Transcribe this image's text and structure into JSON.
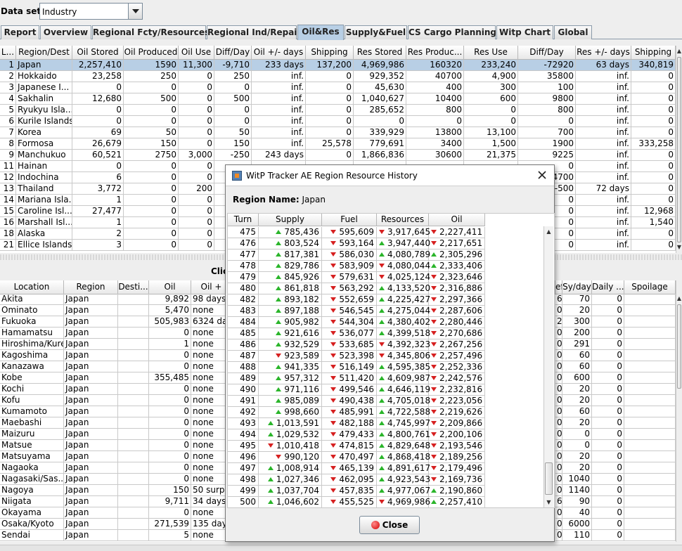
{
  "dataset": {
    "label": "Data set:",
    "value": "Industry"
  },
  "tabs": [
    "Report",
    "Overview",
    "Regional Fcty/Resources",
    "Regional Ind/Repair",
    "Oil&Res",
    "Supply&Fuel",
    "CS Cargo Planning",
    "Witp Chart",
    "Global"
  ],
  "active_tab": "Oil&Res",
  "region_table": {
    "columns": [
      "L...",
      "Region/Dest",
      "Oil Stored",
      "Oil Produced",
      "Oil Use",
      "Diff/Day",
      "Oil +/- days",
      "Shipping",
      "Res Stored",
      "Res Produc...",
      "Res Use",
      "Diff/Day",
      "Res +/- days",
      "Shipping"
    ],
    "rows": [
      [
        "1",
        "Japan",
        "2,257,410",
        "1590",
        "11,300",
        "-9,710",
        "233 days",
        "137,200",
        "4,969,986",
        "160320",
        "233,240",
        "-72920",
        "63 days",
        "340,819"
      ],
      [
        "2",
        "Hokkaido",
        "23,258",
        "250",
        "0",
        "250",
        "inf.",
        "0",
        "929,352",
        "40700",
        "4,900",
        "35800",
        "inf.",
        "0"
      ],
      [
        "3",
        "Japanese I...",
        "0",
        "0",
        "0",
        "0",
        "inf.",
        "0",
        "45,630",
        "400",
        "300",
        "100",
        "inf.",
        "0"
      ],
      [
        "4",
        "Sakhalin",
        "12,680",
        "500",
        "0",
        "500",
        "inf.",
        "0",
        "1,040,627",
        "10400",
        "600",
        "9800",
        "inf.",
        "0"
      ],
      [
        "5",
        "Ryukyu Isla...",
        "0",
        "0",
        "0",
        "0",
        "inf.",
        "0",
        "285,652",
        "800",
        "0",
        "800",
        "inf.",
        "0"
      ],
      [
        "6",
        "Kurile Islands",
        "0",
        "0",
        "0",
        "0",
        "inf.",
        "0",
        "0",
        "0",
        "0",
        "0",
        "inf.",
        "0"
      ],
      [
        "7",
        "Korea",
        "69",
        "50",
        "0",
        "50",
        "inf.",
        "0",
        "339,929",
        "13800",
        "13,100",
        "700",
        "inf.",
        "0"
      ],
      [
        "8",
        "Formosa",
        "26,679",
        "150",
        "0",
        "150",
        "inf.",
        "25,578",
        "779,691",
        "3400",
        "1,500",
        "1900",
        "inf.",
        "333,258"
      ],
      [
        "9",
        "Manchukuo",
        "60,521",
        "2750",
        "3,000",
        "-250",
        "243 days",
        "0",
        "1,866,836",
        "30600",
        "21,375",
        "9225",
        "inf.",
        "0"
      ],
      [
        "11",
        "Hainan",
        "0",
        "0",
        "0",
        "",
        "",
        "",
        "",
        "",
        "",
        "0",
        "inf.",
        "0"
      ],
      [
        "12",
        "Indochina",
        "6",
        "0",
        "0",
        "",
        "",
        "",
        "",
        "",
        "",
        "4700",
        "inf.",
        "0"
      ],
      [
        "13",
        "Thailand",
        "3,772",
        "0",
        "200",
        "",
        "",
        "",
        "",
        "",
        "",
        "-500",
        "72 days",
        "0"
      ],
      [
        "14",
        "Mariana Isla...",
        "1",
        "0",
        "0",
        "",
        "",
        "",
        "",
        "",
        "",
        "0",
        "inf.",
        "0"
      ],
      [
        "15",
        "Caroline Isl...",
        "27,477",
        "0",
        "0",
        "",
        "",
        "",
        "",
        "",
        "",
        "0",
        "inf.",
        "12,968"
      ],
      [
        "16",
        "Marshall Isl...",
        "1",
        "0",
        "0",
        "",
        "",
        "",
        "",
        "",
        "",
        "0",
        "inf.",
        "1,540"
      ],
      [
        "18",
        "Alaska",
        "2",
        "0",
        "0",
        "",
        "",
        "",
        "",
        "",
        "",
        "0",
        "inf.",
        "0"
      ],
      [
        "21",
        "Ellice Islands",
        "3",
        "0",
        "0",
        "",
        "",
        "",
        "",
        "",
        "",
        "0",
        "inf.",
        "0"
      ]
    ]
  },
  "location_caption": "Clic",
  "location_table": {
    "columns": [
      "Location",
      "Region",
      "Desti...",
      "Oil",
      "Oil +",
      "",
      "",
      "",
      "",
      "",
      "",
      "ef",
      "Sy/day",
      "Daily ...",
      "Spoilage"
    ],
    "rows": [
      [
        "Akita",
        "Japan",
        "",
        "9,892",
        "98 days",
        "60",
        "70",
        "0"
      ],
      [
        "Ominato",
        "Japan",
        "",
        "5,470",
        "none",
        "0",
        "20",
        "0"
      ],
      [
        "Fukuoka",
        "Japan",
        "",
        "505,983",
        "6324 da",
        "20",
        "300",
        "0"
      ],
      [
        "Hamamatsu",
        "Japan",
        "",
        "0",
        "none",
        "0",
        "200",
        "0"
      ],
      [
        "Hiroshima/Kure",
        "Japan",
        "",
        "1",
        "none",
        "0",
        "291",
        "0"
      ],
      [
        "Kagoshima",
        "Japan",
        "",
        "0",
        "none",
        "0",
        "60",
        "0"
      ],
      [
        "Kanazawa",
        "Japan",
        "",
        "0",
        "none",
        "0",
        "60",
        "0"
      ],
      [
        "Kobe",
        "Japan",
        "",
        "355,485",
        "none",
        "0",
        "600",
        "0"
      ],
      [
        "Kochi",
        "Japan",
        "",
        "0",
        "none",
        "0",
        "20",
        "0"
      ],
      [
        "Kofu",
        "Japan",
        "",
        "0",
        "none",
        "0",
        "20",
        "0"
      ],
      [
        "Kumamoto",
        "Japan",
        "",
        "0",
        "none",
        "0",
        "60",
        "0"
      ],
      [
        "Maebashi",
        "Japan",
        "",
        "0",
        "none",
        "0",
        "20",
        "0"
      ],
      [
        "Maizuru",
        "Japan",
        "",
        "0",
        "none",
        "0",
        "0",
        "0"
      ],
      [
        "Matsue",
        "Japan",
        "",
        "0",
        "none",
        "0",
        "0",
        "0"
      ],
      [
        "Matsuyama",
        "Japan",
        "",
        "0",
        "none",
        "0",
        "20",
        "0"
      ],
      [
        "Nagaoka",
        "Japan",
        "",
        "0",
        "none",
        "0",
        "20",
        "0"
      ],
      [
        "Nagasaki/Sas...",
        "Japan",
        "",
        "0",
        "none",
        "0",
        "1040",
        "0"
      ],
      [
        "Nagoya",
        "Japan",
        "",
        "150",
        "50 surpl",
        "0",
        "1140",
        "0"
      ],
      [
        "Niigata",
        "Japan",
        "",
        "9,711",
        "34 days",
        "60",
        "90",
        "0"
      ],
      [
        "Okayama",
        "Japan",
        "",
        "0",
        "none",
        "0",
        "40",
        "0"
      ],
      [
        "Osaka/Kyoto",
        "Japan",
        "",
        "271,539",
        "135 days",
        "00",
        "6000",
        "0"
      ],
      [
        "Sendai",
        "Japan",
        "",
        "5",
        "none",
        "0",
        "110",
        "0"
      ]
    ]
  },
  "dialog": {
    "title": "WitP Tracker AE Region Resource History",
    "region_label": "Region Name:",
    "region_value": "Japan",
    "columns": [
      "Turn",
      "Supply",
      "Fuel",
      "Resources",
      "Oil"
    ],
    "rows": [
      [
        "475",
        "up",
        "785,436",
        "down",
        "595,609",
        "down",
        "3,917,645",
        "down",
        "2,227,411"
      ],
      [
        "476",
        "up",
        "803,524",
        "down",
        "593,164",
        "up",
        "3,947,440",
        "down",
        "2,217,651"
      ],
      [
        "477",
        "up",
        "817,381",
        "down",
        "586,030",
        "up",
        "4,080,789",
        "up",
        "2,305,296"
      ],
      [
        "478",
        "up",
        "829,786",
        "down",
        "583,909",
        "down",
        "4,080,044",
        "up",
        "2,333,406"
      ],
      [
        "479",
        "up",
        "845,926",
        "down",
        "579,631",
        "down",
        "4,025,124",
        "down",
        "2,323,646"
      ],
      [
        "480",
        "up",
        "861,818",
        "down",
        "563,292",
        "up",
        "4,133,520",
        "down",
        "2,316,886"
      ],
      [
        "482",
        "up",
        "893,182",
        "down",
        "552,659",
        "up",
        "4,225,427",
        "down",
        "2,297,366"
      ],
      [
        "483",
        "up",
        "897,188",
        "down",
        "546,545",
        "up",
        "4,275,044",
        "down",
        "2,287,606"
      ],
      [
        "484",
        "up",
        "905,982",
        "down",
        "544,304",
        "up",
        "4,380,402",
        "down",
        "2,280,446"
      ],
      [
        "485",
        "up",
        "921,616",
        "down",
        "536,077",
        "up",
        "4,399,518",
        "down",
        "2,270,686"
      ],
      [
        "486",
        "up",
        "932,529",
        "down",
        "533,685",
        "down",
        "4,392,323",
        "down",
        "2,267,256"
      ],
      [
        "487",
        "down",
        "923,589",
        "down",
        "523,398",
        "down",
        "4,345,806",
        "down",
        "2,257,496"
      ],
      [
        "488",
        "up",
        "941,335",
        "down",
        "516,149",
        "up",
        "4,595,385",
        "down",
        "2,252,336"
      ],
      [
        "489",
        "up",
        "957,312",
        "down",
        "511,420",
        "up",
        "4,609,987",
        "down",
        "2,242,576"
      ],
      [
        "490",
        "up",
        "971,116",
        "down",
        "499,546",
        "up",
        "4,646,119",
        "down",
        "2,232,816"
      ],
      [
        "491",
        "up",
        "985,089",
        "down",
        "490,438",
        "up",
        "4,705,018",
        "down",
        "2,223,056"
      ],
      [
        "492",
        "up",
        "998,660",
        "down",
        "485,991",
        "up",
        "4,722,588",
        "down",
        "2,219,626"
      ],
      [
        "493",
        "up",
        "1,013,591",
        "down",
        "482,188",
        "up",
        "4,745,997",
        "down",
        "2,209,866"
      ],
      [
        "494",
        "up",
        "1,029,532",
        "down",
        "479,433",
        "up",
        "4,800,761",
        "down",
        "2,200,106"
      ],
      [
        "495",
        "down",
        "1,010,418",
        "down",
        "474,815",
        "up",
        "4,829,648",
        "down",
        "2,193,546"
      ],
      [
        "496",
        "down",
        "990,120",
        "down",
        "470,497",
        "up",
        "4,868,418",
        "down",
        "2,189,256"
      ],
      [
        "497",
        "up",
        "1,008,914",
        "down",
        "465,139",
        "up",
        "4,891,617",
        "down",
        "2,179,496"
      ],
      [
        "498",
        "up",
        "1,027,346",
        "down",
        "462,095",
        "up",
        "4,923,543",
        "down",
        "2,169,736"
      ],
      [
        "499",
        "up",
        "1,037,704",
        "down",
        "457,835",
        "up",
        "4,977,067",
        "up",
        "2,190,860"
      ],
      [
        "500",
        "up",
        "1,046,602",
        "down",
        "455,525",
        "down",
        "4,969,986",
        "up",
        "2,257,410"
      ]
    ],
    "close_label": "Close"
  },
  "colors": {
    "selection": "#b8cfe5",
    "up": "#2ab52a",
    "down": "#d62020"
  }
}
